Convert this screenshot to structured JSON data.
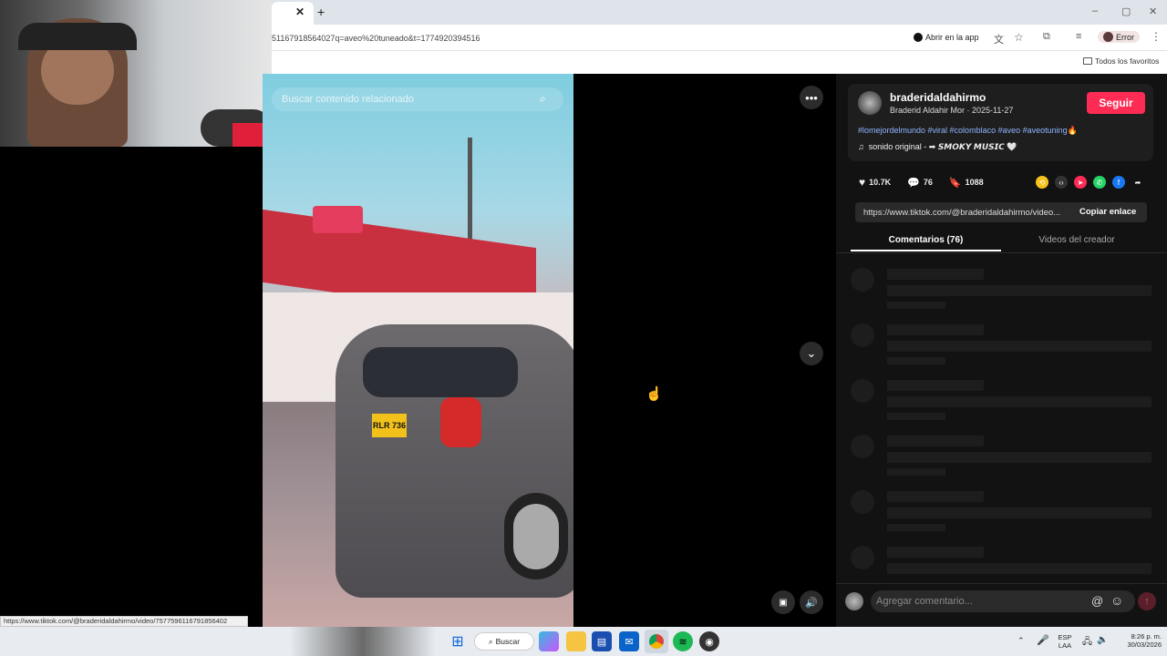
{
  "browser": {
    "url": "51167918564027q=aveo%20tuneado&t=1774920394516",
    "open_in_app": "Abrir en la app",
    "profile_label": "Error",
    "bookmarks_label": "Todos los favoritos",
    "tab_close": "✕",
    "new_tab": "+"
  },
  "video": {
    "search_placeholder": "Buscar contenido relacionado",
    "plate": "RLR 736",
    "more_icon": "more-icon"
  },
  "author": {
    "username": "braderidaldahirmo",
    "display_line": "Braderid Aldahir Mor · 2025-11-27",
    "follow_label": "Seguir",
    "hashtags": "#lomejordelmundo #viral #colomblaco #aveo #aveotuning🔥",
    "sound": "sonido original - ➡ 𝙎𝙈𝙊𝙆𝙔 𝙈𝙐𝙎𝙄𝘾 🤍"
  },
  "stats": {
    "likes": "10.7K",
    "comments": "76",
    "saves": "1088"
  },
  "share": {
    "link": "https://www.tiktok.com/@braderidaldahirmo/video...",
    "copy_label": "Copiar enlace"
  },
  "tabs": {
    "comments": "Comentarios (76)",
    "creator_videos": "Videos del creador"
  },
  "comment_input": {
    "placeholder": "Agregar comentario..."
  },
  "status_url": "https://www.tiktok.com/@braderidaldahirmo/video/7577596116791856402",
  "taskbar": {
    "search_label": "Buscar",
    "lang_top": "ESP",
    "lang_bottom": "LAA",
    "time": "8:26 p. m.",
    "date": "30/03/2026"
  },
  "colors": {
    "accent": "#fe2c55",
    "panel": "#121212"
  }
}
